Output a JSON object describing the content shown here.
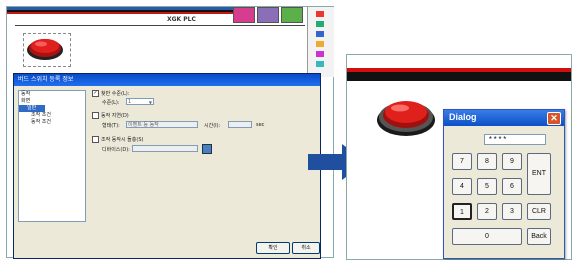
{
  "left": {
    "plc_label": "XGK PLC",
    "dialog_title": "버드 스위치 등록 정보",
    "tree": [
      "동작",
      "화면",
      "일반",
      "조작 조건",
      "동작 조건"
    ],
    "options": {
      "option1_label": "찾반 수준(L):",
      "option1_sub_label": "수준(L):",
      "option1_value": "1",
      "option2_label": "동작 지연(D)",
      "option2_field_label": "형태(T):",
      "option2_field_value": "이벤트 등 동작",
      "option2_time_label": "시간(I):",
      "option2_time_unit": "sec",
      "option3_label": "조작 동작시 돌충(S)",
      "option3_device_label": "디바이스(D):"
    },
    "ok_label": "확인",
    "cancel_label": "취소"
  },
  "right": {
    "dialog_title": "Dialog",
    "close_glyph": "✕",
    "display_value": "****",
    "keys": {
      "k7": "7",
      "k8": "8",
      "k9": "9",
      "k4": "4",
      "k5": "5",
      "k6": "6",
      "k1": "1",
      "k2": "2",
      "k3": "3",
      "k0": "0",
      "ent": "ENT",
      "clr": "CLR",
      "back": "Back"
    }
  },
  "colors": {
    "accent_blue": "#1f4f9e",
    "title_blue": "#0b50c7",
    "red_bar": "#d01010",
    "button_red": "#e0201c"
  }
}
